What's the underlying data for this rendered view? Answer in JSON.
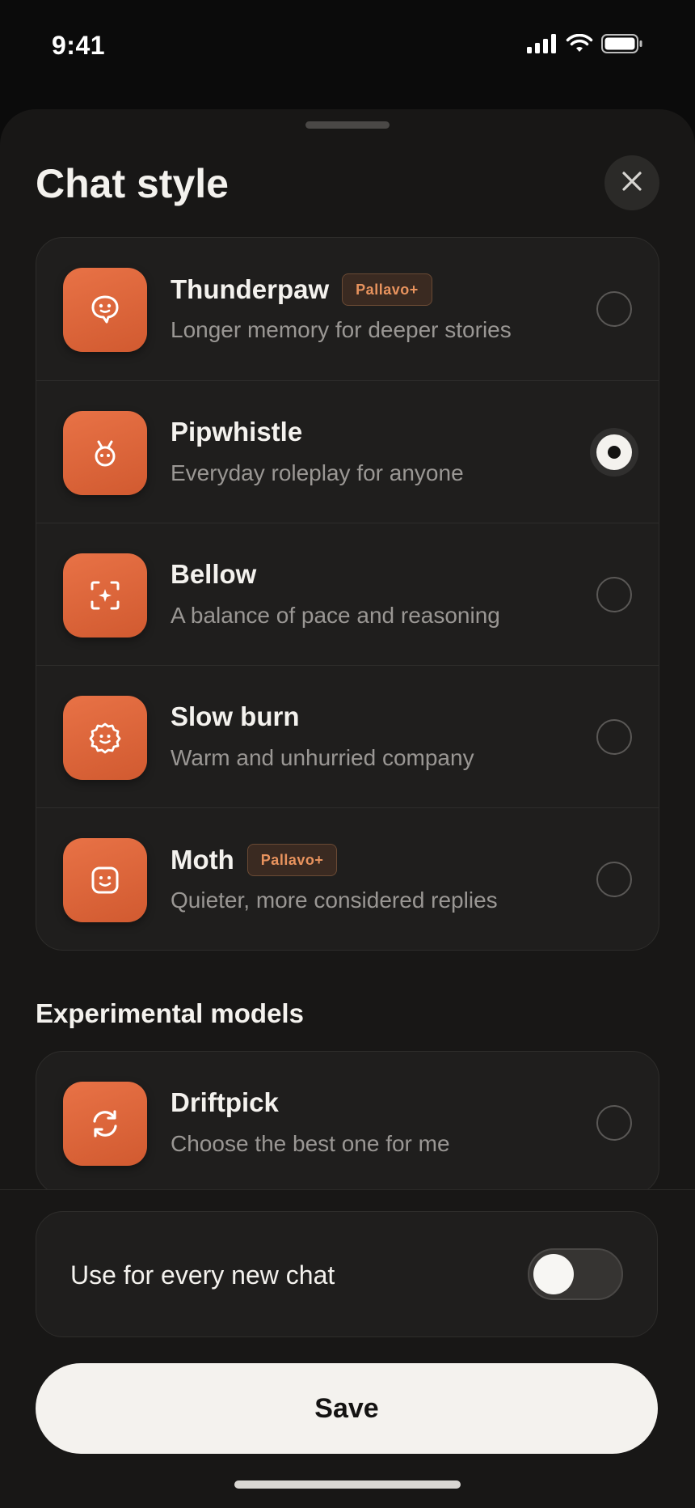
{
  "status_bar": {
    "time": "9:41"
  },
  "sheet": {
    "title": "Chat style"
  },
  "models": [
    {
      "name": "Thunderpaw",
      "badge": "Pallavo+",
      "description": "Longer memory for deeper stories",
      "icon": "speech-bubble-face-icon",
      "selected": false
    },
    {
      "name": "Pipwhistle",
      "badge": "",
      "description": "Everyday roleplay for anyone",
      "icon": "antenna-face-icon",
      "selected": true
    },
    {
      "name": "Bellow",
      "badge": "",
      "description": "A balance of pace and reasoning",
      "icon": "focus-sparkle-icon",
      "selected": false
    },
    {
      "name": "Slow burn",
      "badge": "",
      "description": "Warm and unhurried company",
      "icon": "badge-face-icon",
      "selected": false
    },
    {
      "name": "Moth",
      "badge": "Pallavo+",
      "description": "Quieter, more considered replies",
      "icon": "square-smile-icon",
      "selected": false
    }
  ],
  "experimental": {
    "heading": "Experimental models",
    "models": [
      {
        "name": "Driftpick",
        "badge": "",
        "description": "Choose the best one for me",
        "icon": "refresh-arrows-icon",
        "selected": false
      }
    ]
  },
  "settings": {
    "default_label": "Use for every new chat",
    "default_enabled": false
  },
  "actions": {
    "save_label": "Save"
  },
  "colors": {
    "accent": "#e06a3d",
    "background": "#181716",
    "card": "#1f1e1d",
    "badge_text": "#e8935e"
  }
}
